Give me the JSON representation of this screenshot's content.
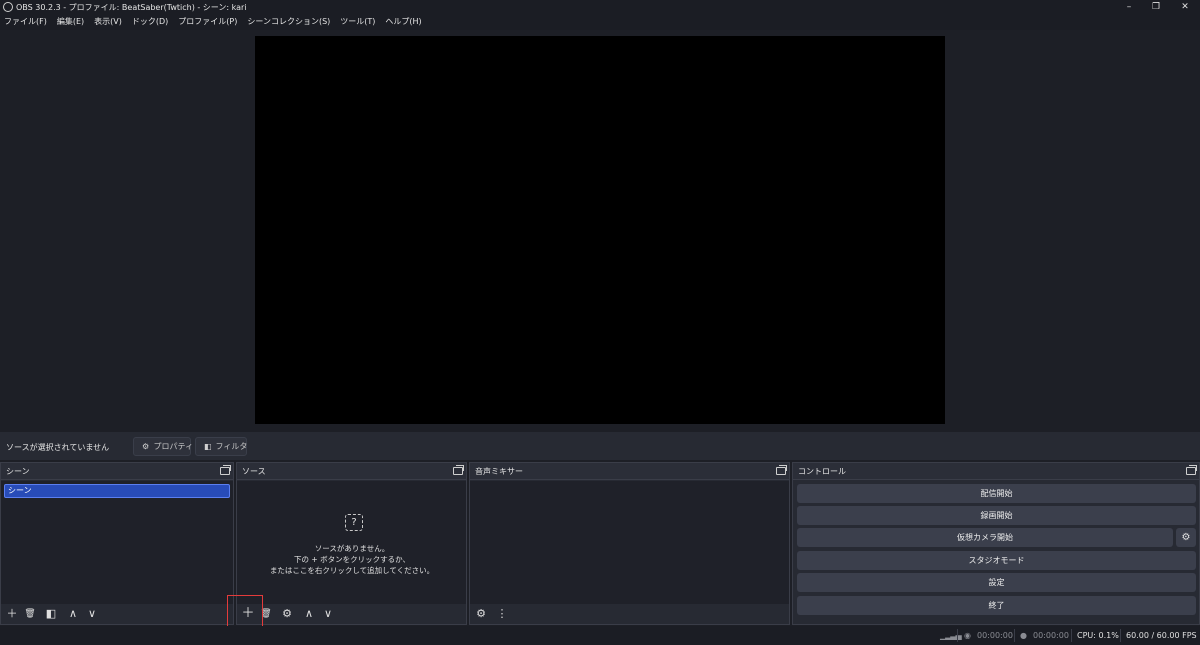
{
  "window": {
    "title": "OBS 30.2.3 - プロファイル: BeatSaber(Twtich) - シーン: kari",
    "minimize": "–",
    "restore": "❐",
    "close": "✕"
  },
  "menu": [
    "ファイル(F)",
    "編集(E)",
    "表示(V)",
    "ドック(D)",
    "プロファイル(P)",
    "シーンコレクション(S)",
    "ツール(T)",
    "ヘルプ(H)"
  ],
  "source_toolbar": {
    "no_source": "ソースが選択されていません",
    "properties": "プロパティ",
    "filters": "フィルタ"
  },
  "scenes": {
    "title": "シーン",
    "items": [
      "シーン"
    ]
  },
  "sources": {
    "title": "ソース",
    "empty_line1": "ソースがありません。",
    "empty_line2": "下の + ボタンをクリックするか、",
    "empty_line3": "またはここを右クリックして追加してください。"
  },
  "mixer": {
    "title": "音声ミキサー"
  },
  "controls": {
    "title": "コントロール",
    "start_streaming": "配信開始",
    "start_recording": "録画開始",
    "start_virtualcam": "仮想カメラ開始",
    "studio_mode": "スタジオモード",
    "settings": "設定",
    "exit": "終了"
  },
  "status": {
    "stream_time": "00:00:00",
    "record_time": "00:00:00",
    "cpu": "CPU: 0.1%",
    "fps": "60.00 / 60.00 FPS"
  },
  "icons": {
    "add": "＋",
    "remove": "🗑",
    "gear": "⚙",
    "up": "∧",
    "down": "∨",
    "more": "⋮",
    "question": "?"
  },
  "colors": {
    "selected_scene": "#284cb8",
    "highlight": "#e33b3b",
    "button": "#3b3f4c"
  }
}
